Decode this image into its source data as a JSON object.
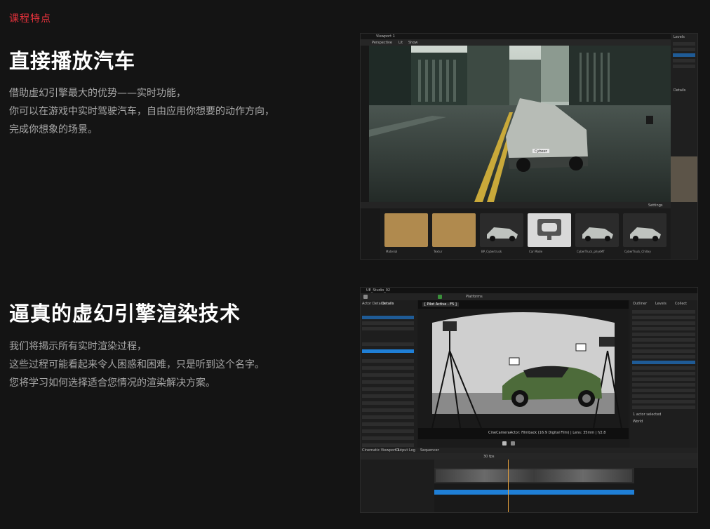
{
  "section_tag": "课程特点",
  "feature1": {
    "title": "直接播放汽车",
    "lines": [
      "借助虚幻引擎最大的优势——实时功能，",
      "你可以在游戏中实时驾驶汽车，自由应用你想要的动作方向，",
      "完成你想象的场景。"
    ]
  },
  "feature2": {
    "title": "逼真的虚幻引擎渲染技术",
    "lines": [
      "我们将揭示所有实时渲染过程，",
      "这些过程可能看起来令人困惑和困难，只是听到这个名字。",
      "您将学习如何选择适合您情况的渲染解决方案。"
    ]
  },
  "shot1": {
    "tab": "Viewport 1",
    "view_btn": "Perspective",
    "lit_btn": "Lit",
    "show_btn": "Show",
    "outliner": "Levels",
    "details_tab": "Details",
    "assets": [
      {
        "label": "Material",
        "kind": "folder"
      },
      {
        "label": "Textur",
        "kind": "folder"
      },
      {
        "label": "BP_Cybertruck",
        "kind": "car"
      },
      {
        "label": "Car Mode",
        "kind": "game"
      },
      {
        "label": "CyberTruck_physMT",
        "kind": "car"
      },
      {
        "label": "CyberTruck_Chillxy",
        "kind": "car"
      }
    ],
    "settings": "Settings",
    "plate": "Cybeer"
  },
  "shot2": {
    "title": "UE_Studio_02",
    "platforms": "Platforms",
    "pilot": "[ Pilot Active - F5 ]",
    "actor": "Actor Details",
    "tabs": [
      "Details",
      "World"
    ],
    "outliner_tabs": [
      "Outliner",
      "Levels",
      "Collect"
    ],
    "timeline_tabs": [
      "Cinematic Viewport 1",
      "Output Log",
      "Sequencer"
    ],
    "cam_name": "CineCameraActor: Filmback (16:9 Digital Film) | Lens: 35mm | f/2.8",
    "fps": "30 fps",
    "selected": "1 actor selected"
  },
  "colors": {
    "accent": "#e8323c",
    "ue_blue": "#1f7fd6"
  }
}
